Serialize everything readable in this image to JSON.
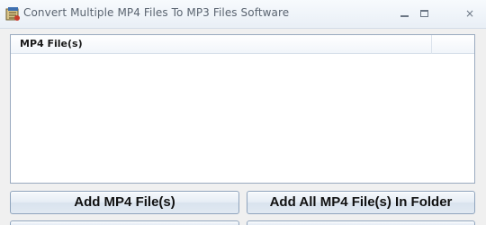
{
  "window": {
    "title": "Convert Multiple MP4 Files To MP3 Files Software",
    "icon": "app-icon",
    "controls": {
      "minimize": "minimize-icon",
      "maximize": "maximize-icon",
      "close": "×"
    }
  },
  "file_list": {
    "columns": [
      "MP4 File(s)"
    ],
    "rows": []
  },
  "buttons": {
    "add_files": "Add MP4 File(s)",
    "add_folder": "Add All MP4 File(s) In Folder"
  },
  "colors": {
    "titlebar": "#eef3f9",
    "list_border": "#9aaabf",
    "button_border": "#8fa4bd"
  }
}
